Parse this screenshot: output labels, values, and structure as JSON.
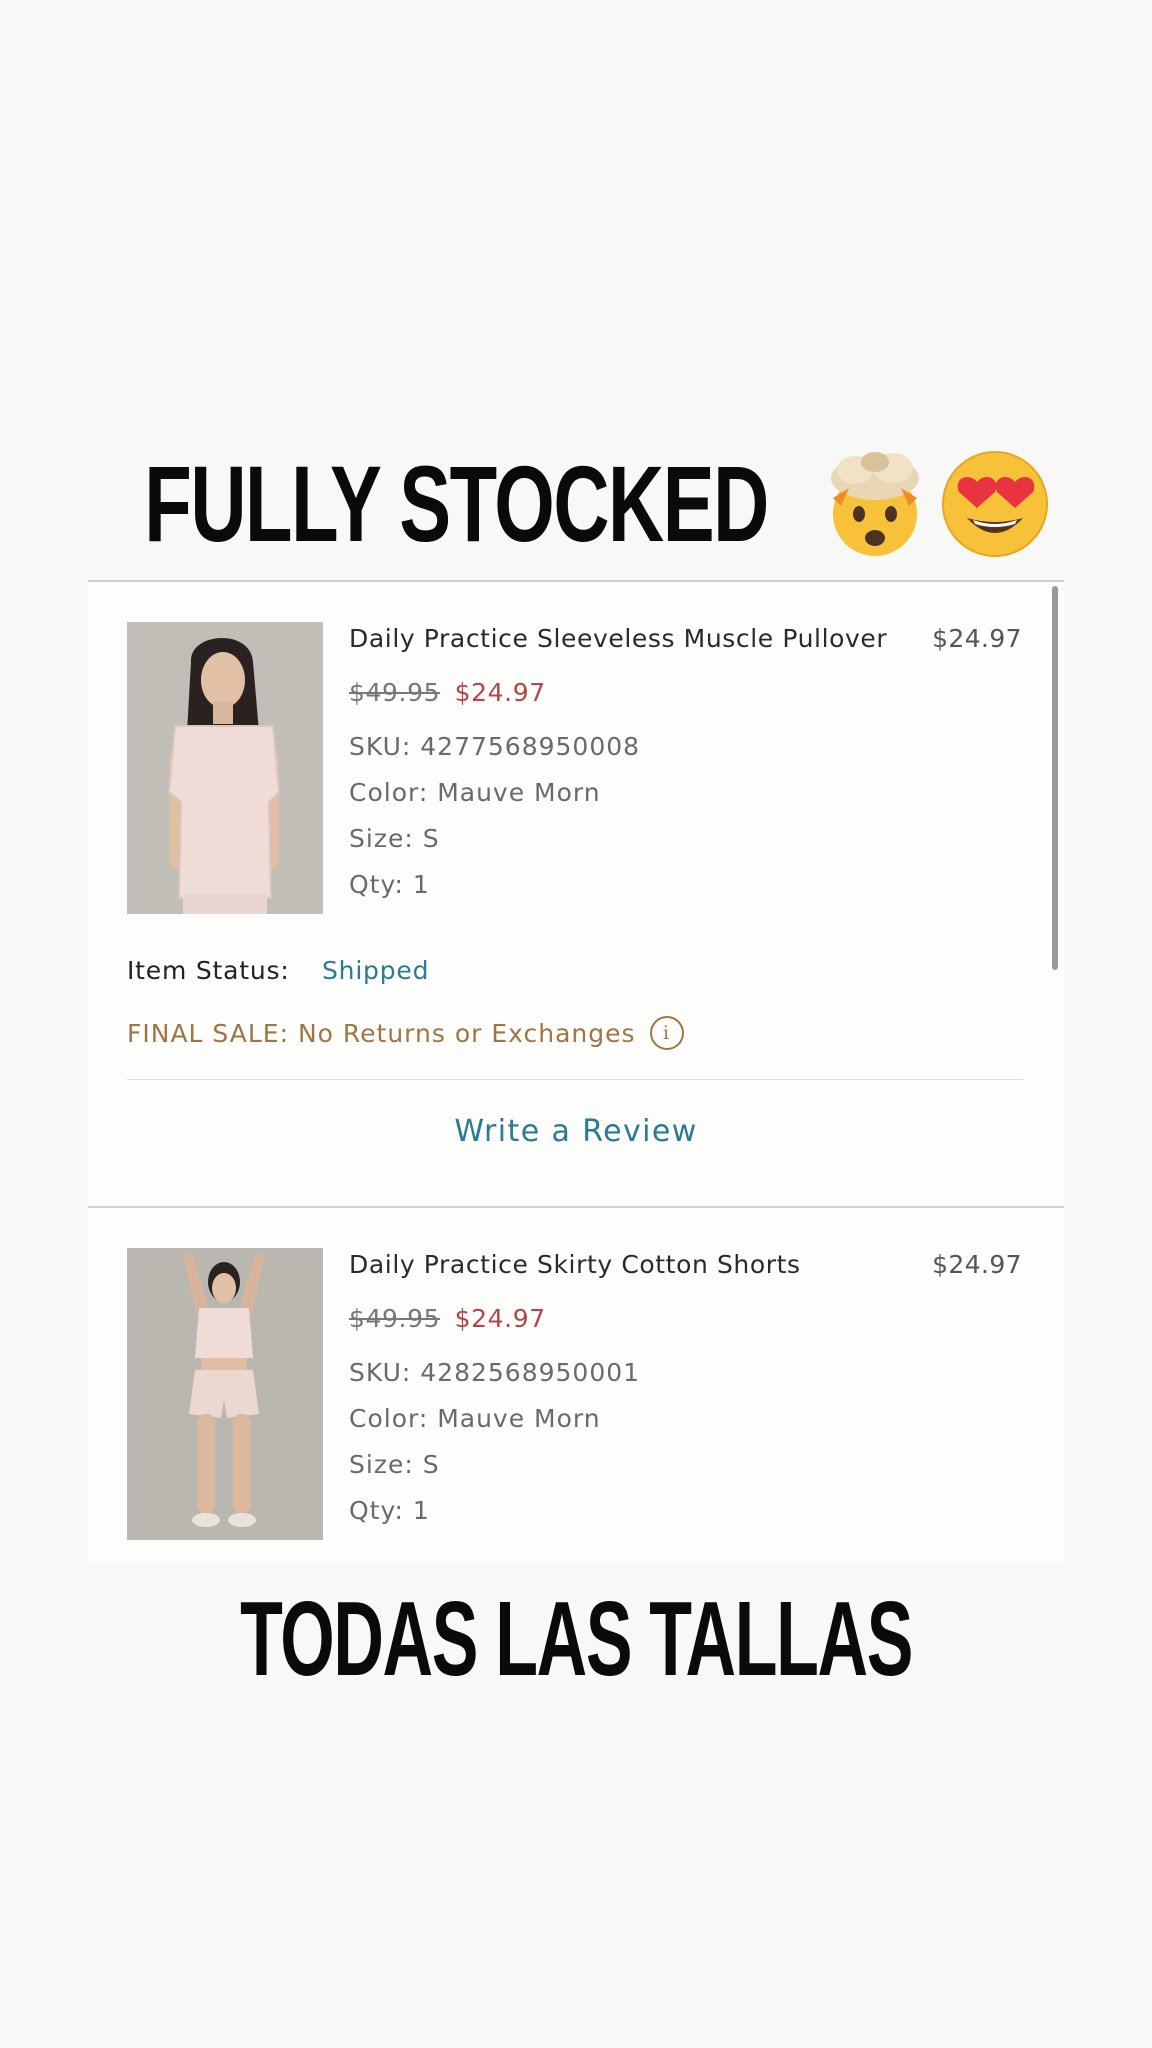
{
  "overlay": {
    "top_headline": "FULLY STOCKED",
    "top_emojis": [
      "exploding-head-emoji",
      "heart-eyes-emoji"
    ],
    "bottom_headline": "TODAS LAS TALLAS"
  },
  "order_items": [
    {
      "name": "Daily Practice Sleeveless Muscle Pullover",
      "line_price": "$24.97",
      "original_price": "$49.95",
      "sale_price": "$24.97",
      "sku": "SKU: 4277568950008",
      "color": "Color: Mauve Morn",
      "size": "Size: S",
      "qty": "Qty: 1",
      "status_label": "Item Status:",
      "status_value": "Shipped",
      "final_sale": "FINAL SALE: No Returns or Exchanges",
      "review_link": "Write a Review"
    },
    {
      "name": "Daily Practice Skirty Cotton Shorts",
      "line_price": "$24.97",
      "original_price": "$49.95",
      "sale_price": "$24.97",
      "sku": "SKU: 4282568950001",
      "color": "Color: Mauve Morn",
      "size": "Size: S",
      "qty": "Qty: 1"
    }
  ],
  "colors": {
    "sale_price": "#b2474a",
    "status_link": "#2a7b93",
    "final_sale": "#9e7545"
  }
}
